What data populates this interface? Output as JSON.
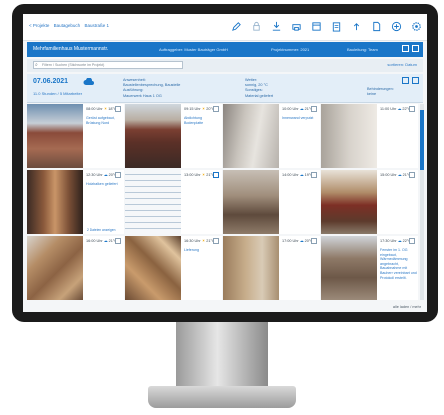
{
  "breadcrumbs": [
    "< Projekte",
    "Bautagebuch",
    "Baustraße 1"
  ],
  "toolbar": [
    "edit-icon",
    "lock-icon",
    "download-icon",
    "print-icon",
    "calendar-icon",
    "clipboard-icon",
    "upload-icon",
    "document-icon",
    "add-icon",
    "settings-icon"
  ],
  "titlebar": {
    "title": "Mehrfamilienhaus Mustermannstr.",
    "meta1": "Auftraggeber: Muster Bauträger GmbH",
    "meta2": "Projektnummer: 2021",
    "meta3": "Bauleitung: Team"
  },
  "filter": {
    "search_placeholder": "Filtern / Suchen (Stichworte im Projekt)",
    "sort_label": "sortieren: Datum"
  },
  "day": {
    "date": "07.06.2021",
    "subtitle": "11.0 Stunden / 5 Mitarbeiter",
    "col1": [
      "Anwesenheit:",
      "Baustellenbesprechung, Baustelle",
      "Ausführung:",
      "Mauerwerk Haus 1 OG"
    ],
    "col2": [
      "Wetter:",
      "sonnig, 20 °C",
      "Sonstiges:",
      "Material geliefert"
    ],
    "col3": [
      "Behinderungen:",
      "keine"
    ]
  },
  "cards": [
    {
      "time": "08:00 Uhr",
      "weather": "sun",
      "temp": "18°C",
      "caption": "Gerüst aufgebaut, Brüstung Nord",
      "checked": false
    },
    {
      "time": "09:15 Uhr",
      "weather": "sun",
      "temp": "20°C",
      "caption": "Abdichtung Bodenplatte",
      "checked": false
    },
    {
      "time": "10:00 Uhr",
      "weather": "cloud",
      "temp": "21°C",
      "caption": "Innenwand verputzt",
      "checked": false
    },
    {
      "time": "11:00 Uhr",
      "weather": "cloud",
      "temp": "22°C",
      "caption": "",
      "checked": false
    },
    {
      "time": "12:30 Uhr",
      "weather": "cloud",
      "temp": "20°C",
      "caption": "Holzbalken geliefert",
      "checked": false,
      "link": "2 Dateien anzeigen"
    },
    {
      "time": "13:00 Uhr",
      "weather": "sun",
      "temp": "21°C",
      "caption": "",
      "checked": true
    },
    {
      "time": "14:00 Uhr",
      "weather": "cloud",
      "temp": "19°C",
      "caption": "",
      "checked": false
    },
    {
      "time": "15:00 Uhr",
      "weather": "cloud",
      "temp": "21°C",
      "caption": "",
      "checked": false
    },
    {
      "time": "16:00 Uhr",
      "weather": "cloud",
      "temp": "21°C",
      "caption": "",
      "checked": false
    },
    {
      "time": "16:30 Uhr",
      "weather": "sun",
      "temp": "21°C",
      "caption": "Lieferung",
      "checked": false
    },
    {
      "time": "17:00 Uhr",
      "weather": "cloud",
      "temp": "20°C",
      "caption": "",
      "checked": false
    },
    {
      "time": "17:30 Uhr",
      "weather": "cloud",
      "temp": "22°C",
      "caption": "Fenster im 1. OG eingebaut, Wärmedämmung angebracht, Bauabnahme mit Bauherr vereinbart und Protokoll erstellt.",
      "checked": false
    }
  ],
  "footer": "alle laden / mehr"
}
